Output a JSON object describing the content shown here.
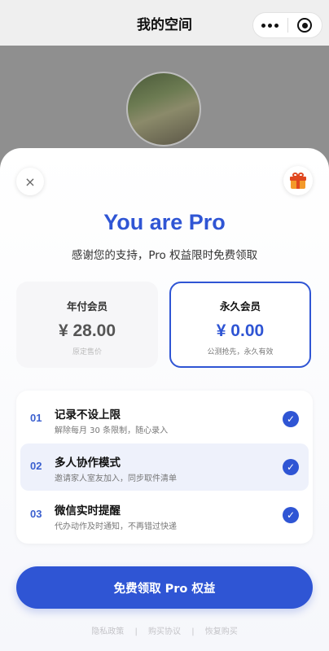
{
  "navbar": {
    "title": "我的空间",
    "more_icon": "more-dots-icon",
    "miniapp_icon": "target-circle-icon"
  },
  "avatar": {
    "description_icon": "user-avatar"
  },
  "sheet": {
    "close_label": "×",
    "gift_icon": "gift-icon",
    "title": "You are Pro",
    "subtitle": "感谢您的支持，Pro 权益限时免费领取",
    "plans": [
      {
        "name": "年付会员",
        "price": "¥ 28.00",
        "note": "原定售价",
        "selected": false
      },
      {
        "name": "永久会员",
        "price": "¥ 0.00",
        "note": "公测抢先，永久有效",
        "selected": true
      }
    ],
    "features": [
      {
        "num": "01",
        "title": "记录不设上限",
        "desc": "解除每月 30 条限制，随心录入",
        "checked": true
      },
      {
        "num": "02",
        "title": "多人协作模式",
        "desc": "邀请家人室友加入，同步取件清单",
        "checked": true
      },
      {
        "num": "03",
        "title": "微信实时提醒",
        "desc": "代办动作及时通知，不再错过快递",
        "checked": true
      }
    ],
    "check_mark": "✓",
    "cta_label": "免费领取 Pro 权益",
    "footer_links": [
      "隐私政策",
      "|",
      "购买协议",
      "|",
      "恢复购买"
    ]
  },
  "colors": {
    "accent": "#2f55d4",
    "highlight_bg": "#eef1fb",
    "backdrop": "#8f8f8f"
  }
}
